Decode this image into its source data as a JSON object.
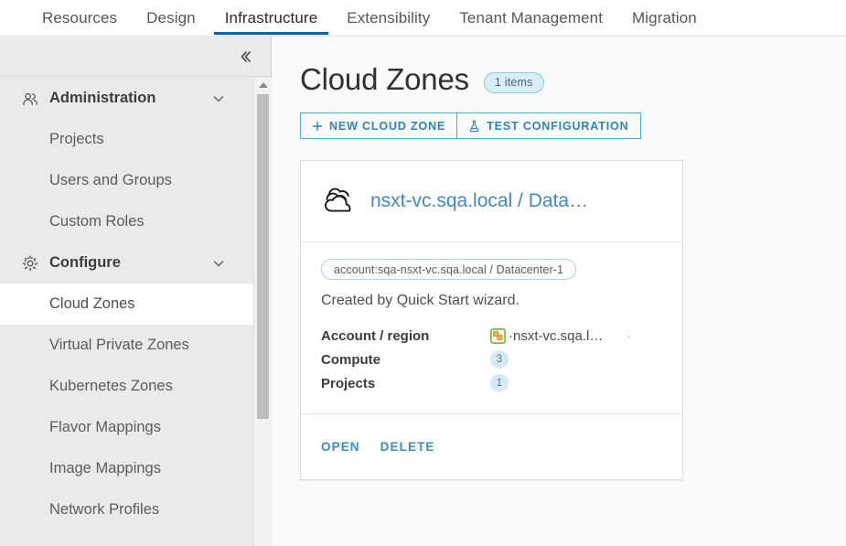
{
  "topnav": {
    "tabs": [
      {
        "label": "Resources",
        "active": false
      },
      {
        "label": "Design",
        "active": false
      },
      {
        "label": "Infrastructure",
        "active": true
      },
      {
        "label": "Extensibility",
        "active": false
      },
      {
        "label": "Tenant Management",
        "active": false
      },
      {
        "label": "Migration",
        "active": false
      }
    ]
  },
  "sidebar": {
    "collapse_icon": "double-chevron-left-icon",
    "groups": [
      {
        "label": "Administration",
        "icon": "users-group-icon",
        "caret": "chevron-down-icon",
        "items": [
          {
            "label": "Projects",
            "selected": false
          },
          {
            "label": "Users and Groups",
            "selected": false
          },
          {
            "label": "Custom Roles",
            "selected": false
          }
        ]
      },
      {
        "label": "Configure",
        "icon": "gear-icon",
        "caret": "chevron-down-icon",
        "items": [
          {
            "label": "Cloud Zones",
            "selected": true
          },
          {
            "label": "Virtual Private Zones",
            "selected": false
          },
          {
            "label": "Kubernetes Zones",
            "selected": false
          },
          {
            "label": "Flavor Mappings",
            "selected": false
          },
          {
            "label": "Image Mappings",
            "selected": false
          },
          {
            "label": "Network Profiles",
            "selected": false
          }
        ]
      }
    ]
  },
  "main": {
    "title": "Cloud Zones",
    "items_badge": "1 items",
    "actions": [
      {
        "label": "NEW CLOUD ZONE",
        "icon": "plus-icon"
      },
      {
        "label": "TEST CONFIGURATION",
        "icon": "flask-icon"
      }
    ],
    "card": {
      "icon": "cloud-stack-icon",
      "title": "nsxt-vc.sqa.local / Data…",
      "tag": "account:sqa-nsxt-vc.sqa.local / Datacenter-1",
      "description": "Created by Quick Start wizard.",
      "details": [
        {
          "key": "Account / region",
          "value": "·nsxt-vc.sqa.l…",
          "icon": "vcenter-icon",
          "type": "text",
          "trailing": "·"
        },
        {
          "key": "Compute",
          "value": "3",
          "type": "badge"
        },
        {
          "key": "Projects",
          "value": "1",
          "type": "badge"
        }
      ],
      "footer_actions": [
        {
          "label": "OPEN"
        },
        {
          "label": "DELETE"
        }
      ]
    }
  },
  "colors": {
    "accent_blue": "#0065ab",
    "link_blue": "#3a8dc4",
    "button_border": "#4aaed9",
    "badge_bg": "#d9edf7",
    "sidebar_bg": "#eaeaea"
  }
}
